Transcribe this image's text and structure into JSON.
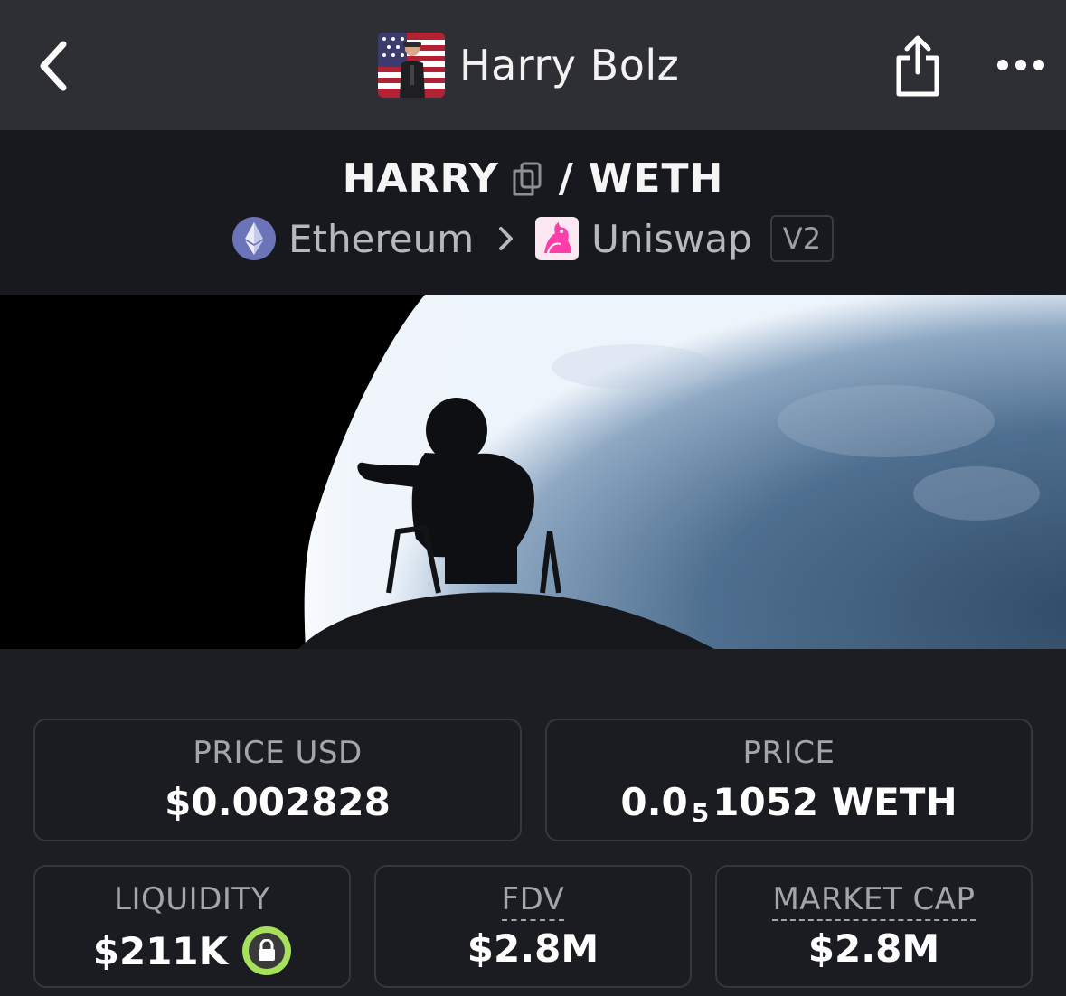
{
  "header": {
    "token_name": "Harry Bolz",
    "back_icon": "chevron-left-icon",
    "share_icon": "share-icon",
    "more_icon": "more-horizontal-icon"
  },
  "pair": {
    "base": "HARRY",
    "separator": "/",
    "quote": "WETH",
    "chain": "Ethereum",
    "dex": "Uniswap",
    "version": "V2"
  },
  "stats": {
    "price_usd": {
      "label": "PRICE USD",
      "value": "$0.002828"
    },
    "price": {
      "label": "PRICE",
      "prefix": "0.0",
      "zeros": "5",
      "suffix": "1052 WETH"
    },
    "liquidity": {
      "label": "LIQUIDITY",
      "value": "$211K"
    },
    "fdv": {
      "label": "FDV",
      "value": "$2.8M"
    },
    "market_cap": {
      "label": "MARKET CAP",
      "value": "$2.8M"
    }
  },
  "colors": {
    "topbar_bg": "#2e2f35",
    "header_bg": "#18191e",
    "page_bg": "#1d1e24",
    "lock_green": "#a7e05a"
  }
}
